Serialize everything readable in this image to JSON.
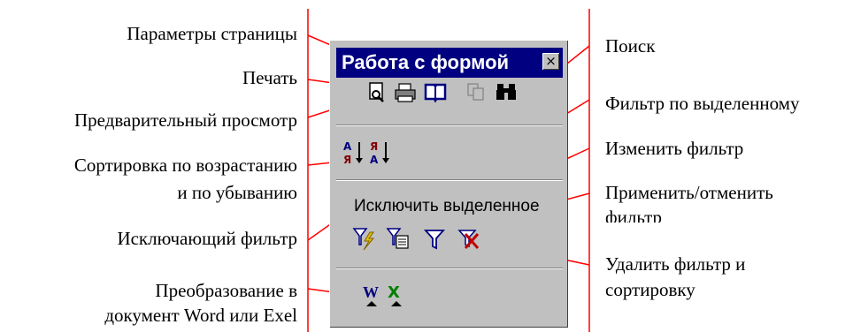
{
  "toolbar": {
    "title": "Работа с формой",
    "close_glyph": "×",
    "exclude_label": "Исключить выделенное"
  },
  "annotations": {
    "left": [
      "Параметры страницы",
      "Печать",
      "Предварительный просмотр",
      "Сортировка по возрастанию",
      "и по убыванию",
      "Исключающий фильтр",
      "Преобразование в",
      "документ Word или Exel"
    ],
    "right": [
      "Поиск",
      "Фильтр по выделенному",
      "Изменить фильтр",
      "Применить/отменить",
      "фильтр",
      "Удалить фильтр и",
      "сортировку"
    ]
  },
  "icons": [
    "print-preview-icon",
    "print-icon",
    "page-setup-icon",
    "copy-icon",
    "find-binoculars-icon",
    "sort-ascending-icon",
    "sort-descending-icon",
    "filter-by-selection-icon",
    "edit-filter-icon",
    "apply-filter-icon",
    "remove-filter-icon",
    "export-word-icon",
    "export-excel-icon"
  ],
  "colors": {
    "title_bar": "#000080",
    "panel": "#c0c0c0",
    "callout_line": "#ff0000"
  }
}
